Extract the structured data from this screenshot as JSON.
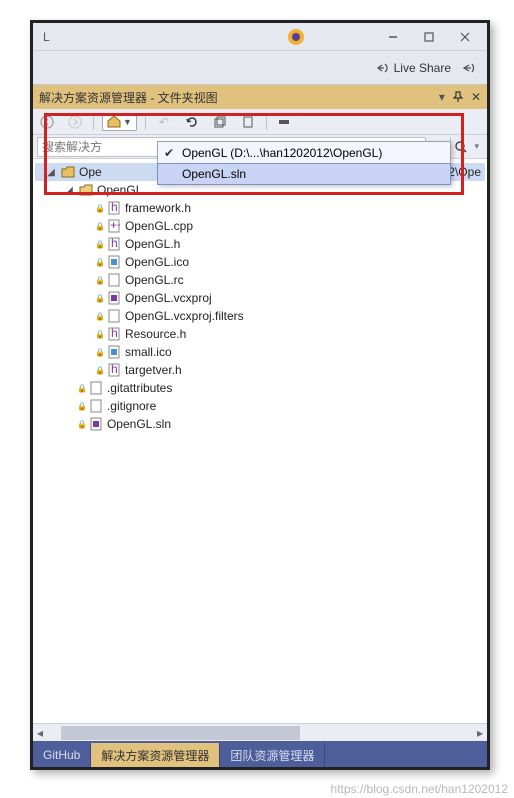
{
  "titlebar": {
    "partial": "L"
  },
  "liveshare": {
    "label": "Live Share"
  },
  "panel": {
    "title": "解决方案资源管理器 - 文件夹视图"
  },
  "search": {
    "placeholder_partial": "搜索解决方"
  },
  "dropdown": {
    "items": [
      {
        "label": "OpenGL (D:\\...\\han1202012\\OpenGL)",
        "checked": true
      },
      {
        "label": "OpenGL.sln",
        "checked": false
      }
    ]
  },
  "tree": {
    "root_partial_left": "Ope",
    "root_partial_right": "2012\\Ope",
    "folder": "OpenGL",
    "files_inner": [
      "framework.h",
      "OpenGL.cpp",
      "OpenGL.h",
      "OpenGL.ico",
      "OpenGL.rc",
      "OpenGL.vcxproj",
      "OpenGL.vcxproj.filters",
      "Resource.h",
      "small.ico",
      "targetver.h"
    ],
    "files_outer": [
      ".gitattributes",
      ".gitignore",
      "OpenGL.sln"
    ]
  },
  "tabs": {
    "items": [
      "GitHub",
      "解决方案资源管理器",
      "团队资源管理器"
    ],
    "active_index": 1
  },
  "watermark": "https://blog.csdn.net/han1202012"
}
